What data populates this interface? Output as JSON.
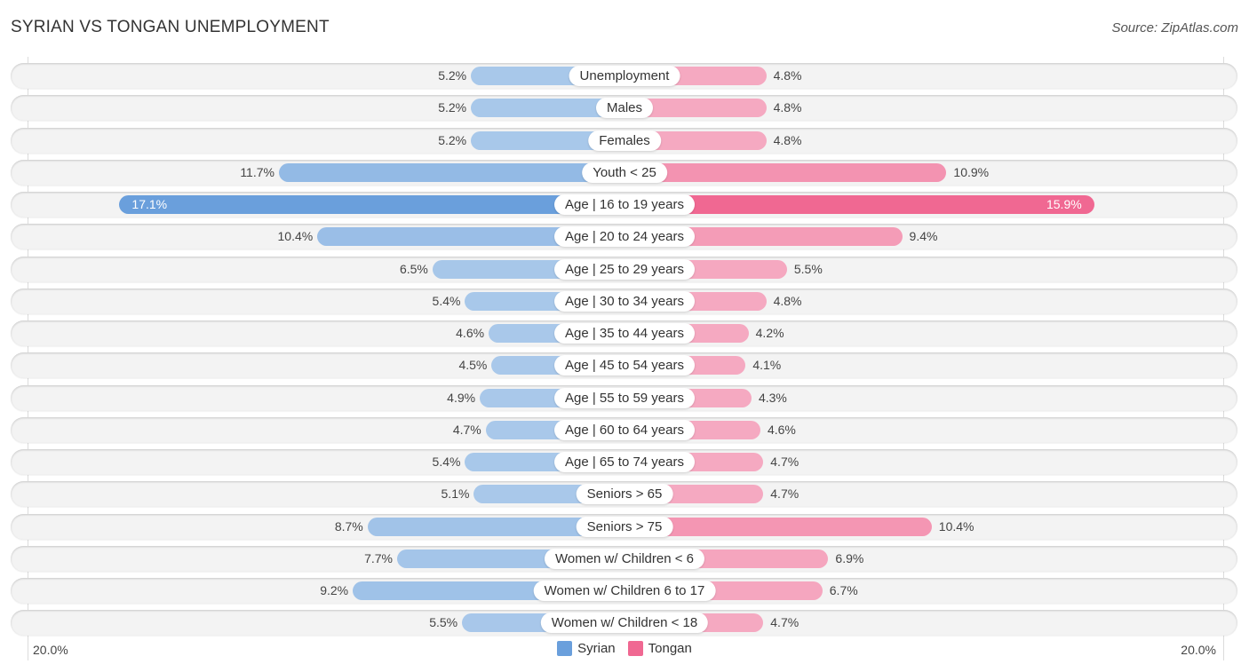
{
  "header": {
    "title": "SYRIAN VS TONGAN UNEMPLOYMENT",
    "source": "Source: ZipAtlas.com"
  },
  "chart_data": {
    "type": "bar",
    "orientation": "horizontal-diverging",
    "title": "SYRIAN VS TONGAN UNEMPLOYMENT",
    "xlabel": "",
    "ylabel": "",
    "xlim": [
      -20.0,
      20.0
    ],
    "axis_labels": {
      "left": "20.0%",
      "right": "20.0%"
    },
    "legend_position": "bottom-center",
    "categories": [
      "Unemployment",
      "Males",
      "Females",
      "Youth < 25",
      "Age | 16 to 19 years",
      "Age | 20 to 24 years",
      "Age | 25 to 29 years",
      "Age | 30 to 34 years",
      "Age | 35 to 44 years",
      "Age | 45 to 54 years",
      "Age | 55 to 59 years",
      "Age | 60 to 64 years",
      "Age | 65 to 74 years",
      "Seniors > 65",
      "Seniors > 75",
      "Women w/ Children < 6",
      "Women w/ Children 6 to 17",
      "Women w/ Children < 18"
    ],
    "series": [
      {
        "name": "Syrian",
        "color": "#6a9fdc",
        "light_color": "#a9c8ea",
        "side": "left",
        "values": [
          5.2,
          5.2,
          5.2,
          11.7,
          17.1,
          10.4,
          6.5,
          5.4,
          4.6,
          4.5,
          4.9,
          4.7,
          5.4,
          5.1,
          8.7,
          7.7,
          9.2,
          5.5
        ],
        "labels": [
          "5.2%",
          "5.2%",
          "5.2%",
          "11.7%",
          "17.1%",
          "10.4%",
          "6.5%",
          "5.4%",
          "4.6%",
          "4.5%",
          "4.9%",
          "4.7%",
          "5.4%",
          "5.1%",
          "8.7%",
          "7.7%",
          "9.2%",
          "5.5%"
        ]
      },
      {
        "name": "Tongan",
        "color": "#f06892",
        "light_color": "#f5a9c1",
        "side": "right",
        "values": [
          4.8,
          4.8,
          4.8,
          10.9,
          15.9,
          9.4,
          5.5,
          4.8,
          4.2,
          4.1,
          4.3,
          4.6,
          4.7,
          4.7,
          10.4,
          6.9,
          6.7,
          4.7
        ],
        "labels": [
          "4.8%",
          "4.8%",
          "4.8%",
          "10.9%",
          "15.9%",
          "9.4%",
          "5.5%",
          "4.8%",
          "4.2%",
          "4.1%",
          "4.3%",
          "4.6%",
          "4.7%",
          "4.7%",
          "10.4%",
          "6.9%",
          "6.7%",
          "4.7%"
        ]
      }
    ]
  },
  "legend": {
    "items": [
      {
        "label": "Syrian",
        "color": "#6a9fdc"
      },
      {
        "label": "Tongan",
        "color": "#f06892"
      }
    ]
  }
}
